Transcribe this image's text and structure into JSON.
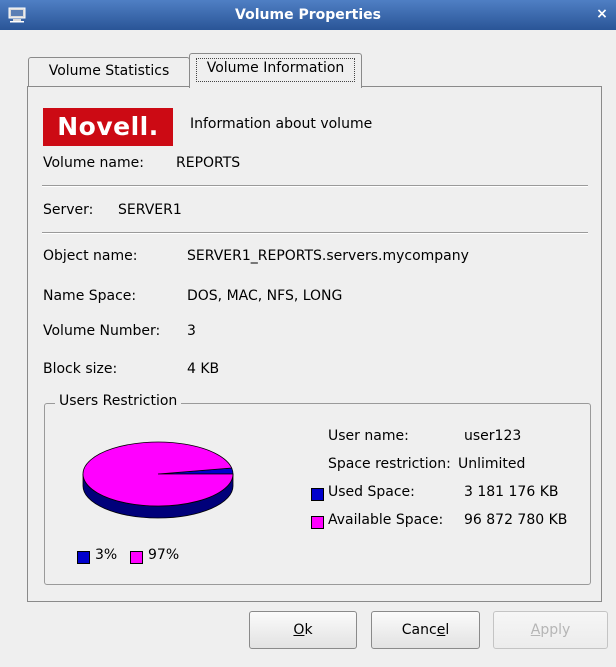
{
  "window": {
    "title": "Volume Properties",
    "close_glyph": "×",
    "app_icon": "computer-icon",
    "titlebar_color": "#3a68ad"
  },
  "tabs": [
    {
      "label": "Volume Statistics",
      "active": false
    },
    {
      "label": "Volume Information",
      "active": true
    }
  ],
  "panel": {
    "logo_text": "Novell.",
    "logo_color": "#cc0a14",
    "heading": "Information about volume",
    "fields": {
      "volume_name_label": "Volume name:",
      "volume_name_value": "REPORTS",
      "server_label": "Server:",
      "server_value": "SERVER1",
      "object_name_label": "Object name:",
      "object_name_value": "SERVER1_REPORTS.servers.mycompany",
      "name_space_label": "Name Space:",
      "name_space_value": "DOS, MAC, NFS, LONG",
      "volume_number_label": "Volume Number:",
      "volume_number_value": "3",
      "block_size_label": "Block size:",
      "block_size_value": "4 KB"
    }
  },
  "users_restriction": {
    "label": "Users Restriction",
    "user_name_label": "User name:",
    "user_name_value": "user123",
    "space_restriction_label": "Space restriction:",
    "space_restriction_value": "Unlimited",
    "used_space_label": "Used Space:",
    "used_space_value": "3 181 176 KB",
    "available_space_label": "Available Space:",
    "available_space_value": "96 872 780 KB",
    "used_color": "#0000cc",
    "available_color": "#ff00ff",
    "legend_used": "3%",
    "legend_available": "97%"
  },
  "chart_data": {
    "type": "pie",
    "categories": [
      "Used Space",
      "Available Space"
    ],
    "values": [
      3,
      97
    ],
    "colors": [
      "#0000cc",
      "#ff00ff"
    ]
  },
  "buttons": {
    "ok": {
      "pre": "",
      "mn": "O",
      "post": "k"
    },
    "cancel": {
      "pre": "Canc",
      "mn": "e",
      "post": "l"
    },
    "apply": {
      "pre": "",
      "mn": "A",
      "post": "pply",
      "disabled": true
    }
  }
}
